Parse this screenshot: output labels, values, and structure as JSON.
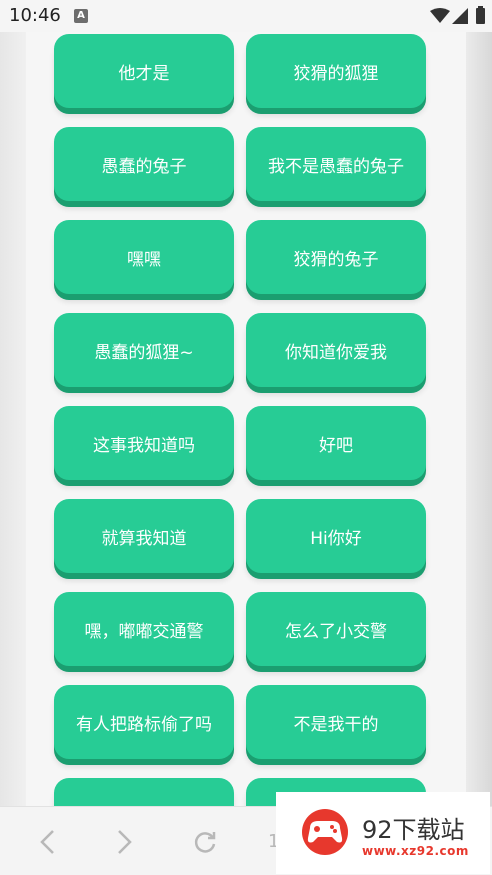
{
  "status_bar": {
    "time": "10:46"
  },
  "buttons": [
    "他才是",
    "狡猾的狐狸",
    "愚蠢的兔子",
    "我不是愚蠢的兔子",
    "嘿嘿",
    "狡猾的兔子",
    "愚蠢的狐狸~",
    "你知道你爱我",
    "这事我知道吗",
    "好吧",
    "就算我知道",
    "Hi你好",
    "嘿，嘟嘟交通警",
    "怎么了小交警",
    "有人把路标偷了吗",
    "不是我干的",
    "",
    ""
  ],
  "browser_nav": {
    "icons": [
      "back-icon",
      "forward-icon",
      "refresh-icon"
    ],
    "partial_label": "1"
  },
  "watermark": {
    "text": "92下载站",
    "url": "www.xz92.com",
    "brand_color": "#e7382d"
  },
  "colors": {
    "button": "#27cc95",
    "button_shadow": "#1b9e70"
  }
}
